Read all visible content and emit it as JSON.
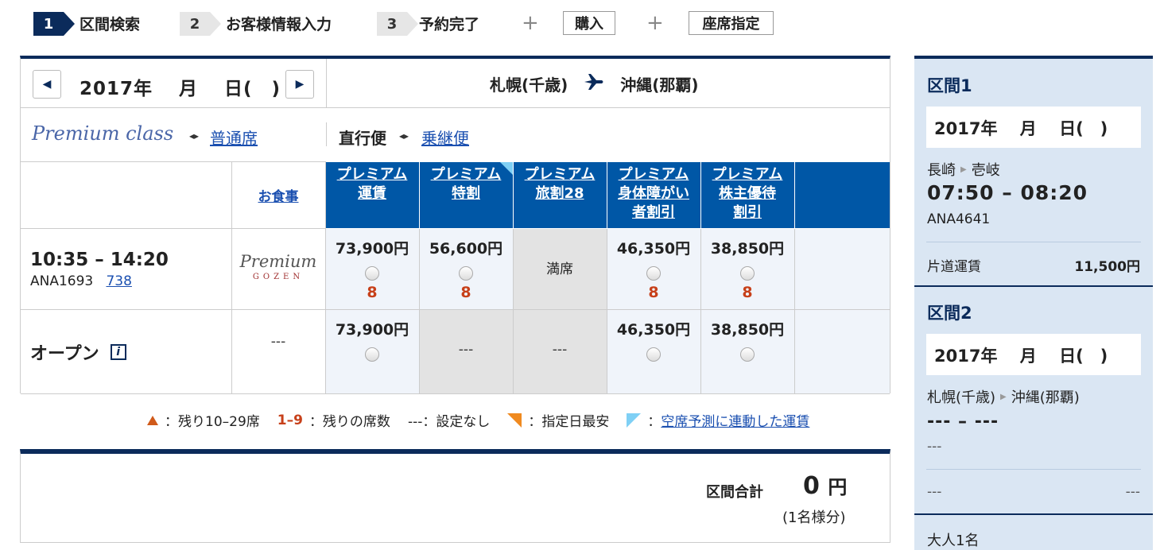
{
  "steps": [
    {
      "num": "1",
      "label": "区間検索"
    },
    {
      "num": "2",
      "label": "お客様情報入力"
    },
    {
      "num": "3",
      "label": "予約完了"
    }
  ],
  "step_plus": "+",
  "options": [
    "購入",
    "座席指定"
  ],
  "date_nav": {
    "prev": "◀",
    "next": "▶",
    "date": "2017年　 月　 日(　)"
  },
  "route": {
    "from": "札幌(千歳)",
    "to": "沖縄(那覇)",
    "icon": "airplane-icon"
  },
  "class_bar": {
    "premium": "Premium class",
    "swap": "◂▸",
    "economy_link": "普通席",
    "direct": "直行便",
    "transfer_link": "乗継便"
  },
  "table": {
    "meal_header": "お食事",
    "fare_headers": [
      [
        "プレミアム",
        "運賃"
      ],
      [
        "プレミアム",
        "特割"
      ],
      [
        "プレミアム",
        "旅割28"
      ],
      [
        "プレミアム",
        "身体障がい",
        "者割引"
      ],
      [
        "プレミアム",
        "株主優待",
        "割引"
      ]
    ],
    "flight": {
      "time": "10:35 – 14:20",
      "number": "ANA1693",
      "aircraft": "738",
      "meal_logo": "Premium",
      "meal_logo_sub": "GOZEN"
    },
    "row1": [
      {
        "price": "73,900円",
        "seats": "8"
      },
      {
        "price": "56,600円",
        "seats": "8"
      },
      {
        "status": "満席"
      },
      {
        "price": "46,350円",
        "seats": "8"
      },
      {
        "price": "38,850円",
        "seats": "8"
      }
    ],
    "open": {
      "label": "オープン",
      "info": "i",
      "meal": "---"
    },
    "row2": [
      {
        "price": "73,900円"
      },
      {
        "status": "---"
      },
      {
        "status": "---"
      },
      {
        "price": "46,350円"
      },
      {
        "price": "38,850円"
      }
    ]
  },
  "legend": {
    "remaining": "：残り10–29席",
    "count_range": "1–9",
    "count_label": "：残りの席数",
    "none": "---：設定なし",
    "cheapest": "：指定日最安",
    "prediction_link": "空席予測に連動した運賃",
    "colon": "："
  },
  "total": {
    "label": "区間合計",
    "value": "0",
    "unit": "円",
    "sub": "(1名様分)"
  },
  "sidebar": {
    "seg1": {
      "title": "区間1",
      "date": "2017年　 月　 日(　)",
      "from": "長崎",
      "to": "壱岐",
      "time": "07:50 – 08:20",
      "flight": "ANA4641",
      "fare_label": "片道運賃",
      "fare": "11,500円"
    },
    "seg2": {
      "title": "区間2",
      "date": "2017年　 月　 日(　)",
      "from": "札幌(千歳)",
      "to": "沖縄(那覇)",
      "time": "--- – ---",
      "flight": "---",
      "fare_label": "---",
      "fare": "---"
    },
    "passengers": "大人1名"
  }
}
